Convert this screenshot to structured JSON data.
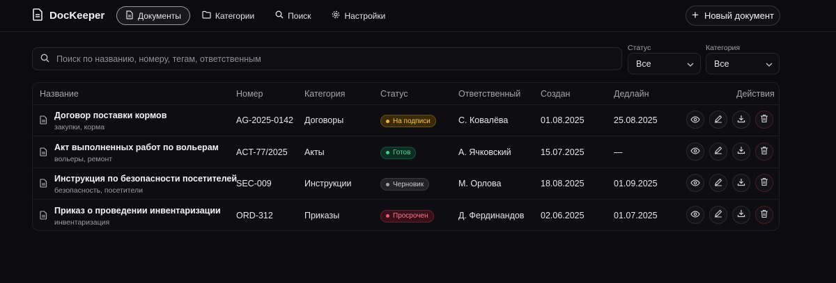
{
  "brand": {
    "name": "DocKeeper"
  },
  "nav": [
    {
      "label": "Документы",
      "icon": "document-icon",
      "active": true
    },
    {
      "label": "Категории",
      "icon": "folder-icon",
      "active": false
    },
    {
      "label": "Поиск",
      "icon": "search-icon",
      "active": false
    },
    {
      "label": "Настройки",
      "icon": "gear-icon",
      "active": false
    }
  ],
  "new_doc_label": "Новый документ",
  "search": {
    "placeholder": "Поиск по названию, номеру, тегам, ответственным",
    "value": ""
  },
  "filters": {
    "status": {
      "label": "Статус",
      "value": "Все"
    },
    "category": {
      "label": "Категория",
      "value": "Все"
    }
  },
  "table": {
    "headers": {
      "name": "Название",
      "number": "Номер",
      "category": "Категория",
      "status": "Статус",
      "owner": "Ответственный",
      "created": "Создан",
      "deadline": "Дедлайн",
      "actions": "Действия"
    },
    "rows": [
      {
        "title": "Договор поставки кормов",
        "tags": "закупки, корма",
        "number": "AG-2025-0142",
        "category": "Договоры",
        "status": "На подписи",
        "owner": "С. Ковалёва",
        "created": "01.08.2025",
        "deadline": "25.08.2025"
      },
      {
        "title": "Акт выполненных работ по вольерам",
        "tags": "вольеры, ремонт",
        "number": "ACT-77/2025",
        "category": "Акты",
        "status": "Готов",
        "owner": "А. Ячковский",
        "created": "15.07.2025",
        "deadline": "—"
      },
      {
        "title": "Инструкция по безопасности посетителей",
        "tags": "безопасность, посетители",
        "number": "SEC-009",
        "category": "Инструкции",
        "status": "Черновик",
        "owner": "М. Орлова",
        "created": "18.08.2025",
        "deadline": "01.09.2025"
      },
      {
        "title": "Приказ о проведении инвентаризации",
        "tags": "инвентаризация",
        "number": "ORD-312",
        "category": "Приказы",
        "status": "Просрочен",
        "owner": "Д. Фердинандов",
        "created": "02.06.2025",
        "deadline": "01.07.2025"
      }
    ]
  },
  "status_colors": {
    "На подписи": {
      "bg": "#3a2a08",
      "border": "#6b4f12",
      "text": "#f2c14e",
      "dot": "#f2b63a"
    },
    "Готов": {
      "bg": "#0c2e22",
      "border": "#16533c",
      "text": "#4fd39a",
      "dot": "#3fcf8e"
    },
    "Черновик": {
      "bg": "#222227",
      "border": "#3a3a42",
      "text": "#c9c9cf",
      "dot": "#a4a4ac"
    },
    "Просрочен": {
      "bg": "#3a1018",
      "border": "#6a1f2c",
      "text": "#f27a8c",
      "dot": "#ef5a70"
    }
  }
}
